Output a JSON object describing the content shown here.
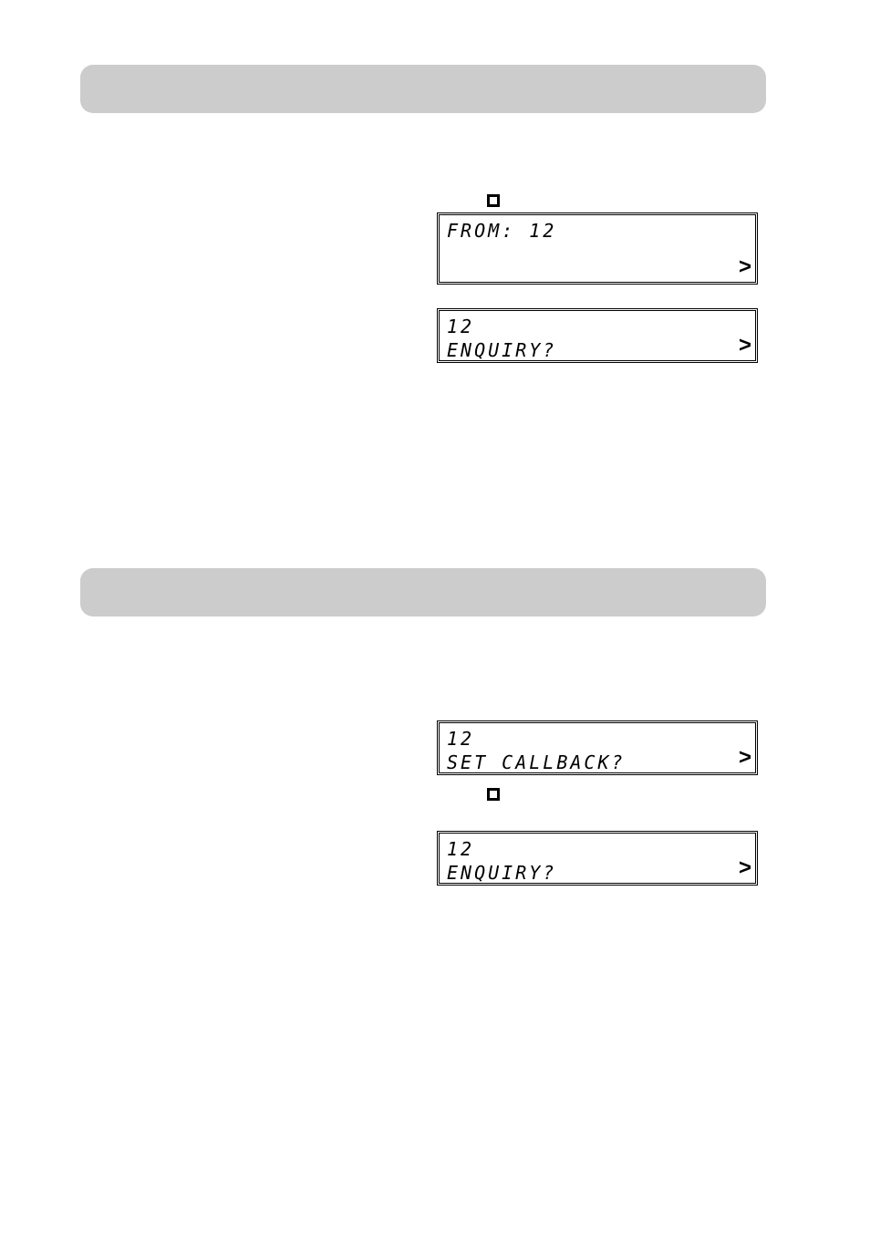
{
  "banners": {
    "banner1": "",
    "banner2": ""
  },
  "screens": {
    "screen1": {
      "line1": "FROM: 12",
      "chevron": ">"
    },
    "screen2": {
      "line1": "12",
      "line2": "ENQUIRY?",
      "chevron": ">"
    },
    "screen3": {
      "line1": "12",
      "line2": "SET CALLBACK?",
      "chevron": ">"
    },
    "screen4": {
      "line1": "12",
      "line2": "ENQUIRY?",
      "chevron": ">"
    }
  }
}
